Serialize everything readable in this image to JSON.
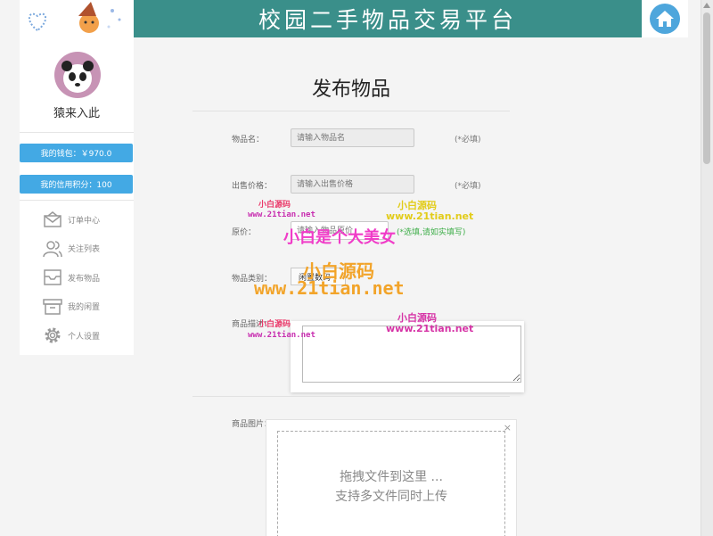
{
  "header": {
    "title": "校园二手物品交易平台"
  },
  "user": {
    "name": "猿来入此",
    "wallet": "我的钱包：￥970.0",
    "credit": "我的信用积分：100"
  },
  "nav": [
    {
      "label": "订单中心",
      "icon": "envelope-icon"
    },
    {
      "label": "关注列表",
      "icon": "users-icon"
    },
    {
      "label": "发布物品",
      "icon": "inbox-icon"
    },
    {
      "label": "我的闲置",
      "icon": "archive-icon"
    },
    {
      "label": "个人设置",
      "icon": "gear-icon"
    }
  ],
  "form": {
    "title": "发布物品",
    "name_label": "物品名：",
    "name_placeholder": "请输入物品名",
    "name_hint": "(*必填)",
    "price_label": "出售价格：",
    "price_placeholder": "请输入出售价格",
    "price_hint": "(*必填)",
    "orig_label": "原价：",
    "orig_placeholder": "请输入物品原价",
    "orig_hint": "(*选填,请如实填写)",
    "category_label": "物品类别：",
    "category_value": "闲置数码",
    "desc_label": "商品描述：",
    "image_label": "商品图片：",
    "drop_line1": "拖拽文件到这里 ...",
    "drop_line2": "支持多文件同时上传",
    "close_glyph": "×"
  },
  "watermarks": {
    "small_cn": "小白源码",
    "small_url": "www.21tian.net",
    "big_cn": "小白是个大美女",
    "mid_cn": "小白源码",
    "big_url": "www.21tian.net"
  },
  "colors": {
    "banner": "#3a8f8a",
    "accent": "#43a9e4"
  }
}
